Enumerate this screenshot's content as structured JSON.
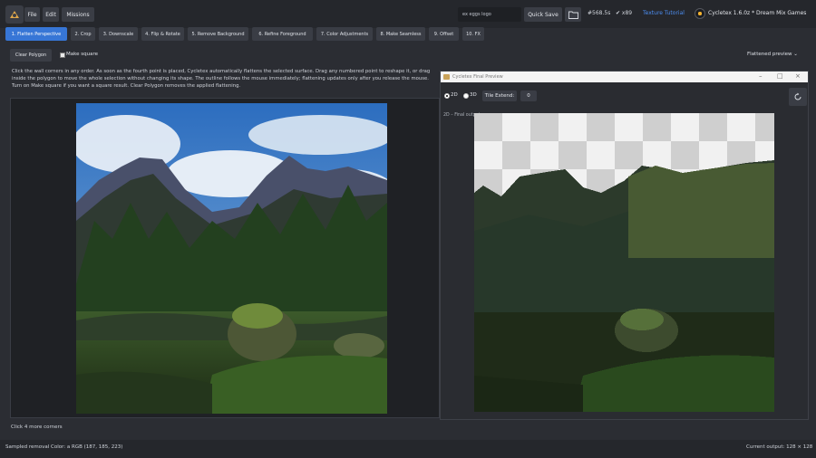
{
  "menu": {
    "file": "File",
    "edit": "Edit",
    "missions": "Missions"
  },
  "topbar": {
    "project_name": "ex eggs logo",
    "quick_save": "Quick Save",
    "stat_a": "#568.5s",
    "stat_b": "✔ x89",
    "tutorials": "Texture Tutorial",
    "brand": "Cycletex 1.6.0z * Dream Mix Games"
  },
  "tabs": [
    "1. Flatten Perspective",
    "2. Crop",
    "3. Downscale",
    "4. Flip & Rotate",
    "5. Remove Background",
    "6. Refine Foreground",
    "7. Color Adjustments",
    "8. Make Seamless",
    "9. Offset",
    "10. FX"
  ],
  "toolbar": {
    "clear_polygon": "Clear Polygon",
    "make_square": "Make square",
    "preview_mode": "Flattened preview ⌄"
  },
  "instructions": "Click the wall corners in any order. As soon as the fourth point is placed, Cycletex automatically flattens the selected surface. Drag any numbered point to reshape it, or drag inside the polygon to move the whole selection without changing its shape. The outline follows the mouse immediately; flattening updates only after you release the mouse. Turn on Make square if you want a square result. Clear Polygon removes the applied flattening.",
  "preview_window": {
    "title": "Cycletex Final Preview",
    "mode_2d": "2D",
    "mode_3d": "3D",
    "tile_extend": "Tile Extend:",
    "tile_value": "0",
    "final_output": "2D – Final output"
  },
  "status": {
    "corners": "Click 4 more corners",
    "sampled_color": "Sampled removal Color: a RGB (187, 185, 223)",
    "current_output": "Current output: 128 × 128"
  },
  "colors": {
    "accent": "#3776d6",
    "background": "#2b2d33",
    "panel": "#3a3d45"
  }
}
